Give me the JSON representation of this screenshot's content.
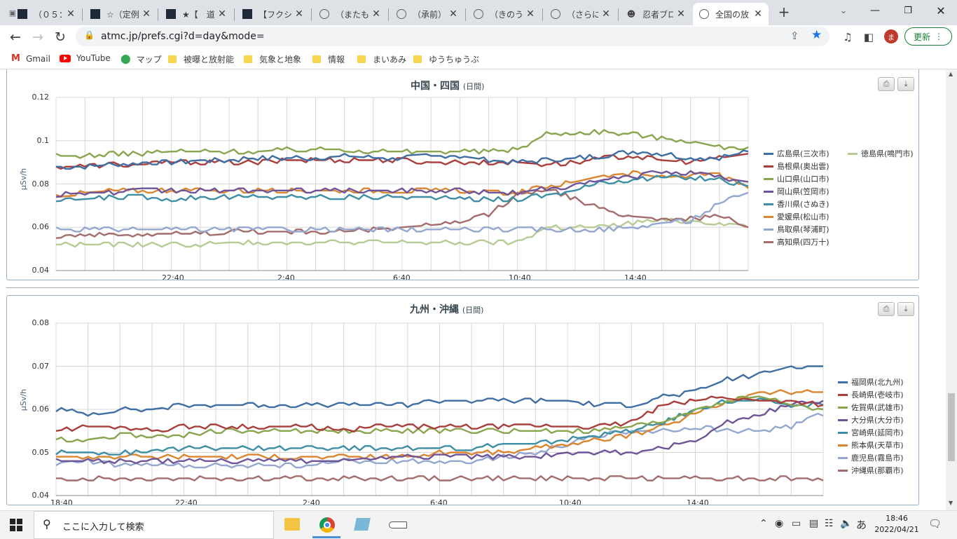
{
  "tabs": [
    {
      "title": "（０５：",
      "icon": "site-dark-icon"
    },
    {
      "title": "☆（定例",
      "icon": "site-dark-icon"
    },
    {
      "title": "★【　道",
      "icon": "site-dark-icon"
    },
    {
      "title": "【フクシマ",
      "icon": "site-dark-icon"
    },
    {
      "title": "（またも",
      "icon": "globe-icon"
    },
    {
      "title": "（承前）",
      "icon": "globe-icon"
    },
    {
      "title": "（きのう",
      "icon": "globe-icon"
    },
    {
      "title": "（さらに",
      "icon": "globe-icon"
    },
    {
      "title": "忍者ブロ",
      "icon": "ninja-icon"
    },
    {
      "title": "全国の放",
      "icon": "globe-icon"
    }
  ],
  "address": {
    "url": "atmc.jp/prefs.cgi?d=day&mode="
  },
  "profile": {
    "initial": "ま"
  },
  "update_button": {
    "label": "更新"
  },
  "bookmarks": [
    {
      "label": "Gmail",
      "icon": "gmail-icon"
    },
    {
      "label": "YouTube",
      "icon": "youtube-icon"
    },
    {
      "label": "マップ",
      "icon": "maps-icon"
    },
    {
      "label": "被曝と放射能",
      "icon": "folder-icon"
    },
    {
      "label": "気象と地象",
      "icon": "folder-icon"
    },
    {
      "label": "情報",
      "icon": "folder-icon"
    },
    {
      "label": "まいあみ",
      "icon": "folder-icon"
    },
    {
      "label": "ゆうちゅうぶ",
      "icon": "folder-icon"
    }
  ],
  "chart_data": [
    {
      "type": "line",
      "title": "中国・四国",
      "subtitle": "(日間)",
      "ylabel": "μSv/h",
      "ylim": [
        0.04,
        0.12
      ],
      "yticks": [
        "0.12",
        "0.1",
        "0.08",
        "0.06",
        "0.04"
      ],
      "xticks": [
        "22:40",
        "2:40",
        "6:40",
        "10:40",
        "14:40"
      ],
      "grid": true,
      "legend_position": "right",
      "x_hours": [
        0,
        1,
        2,
        3,
        4,
        5,
        6,
        7,
        8,
        9,
        10,
        11,
        12,
        13,
        14,
        15,
        16,
        17,
        18,
        19,
        20,
        21,
        22,
        23,
        24
      ],
      "series": [
        {
          "name": "広島県(三次市)",
          "color": "#3f6ea3",
          "values": [
            0.088,
            0.088,
            0.089,
            0.09,
            0.09,
            0.091,
            0.091,
            0.092,
            0.092,
            0.092,
            0.093,
            0.092,
            0.092,
            0.093,
            0.093,
            0.091,
            0.09,
            0.091,
            0.092,
            0.093,
            0.095,
            0.094,
            0.092,
            0.092,
            0.095
          ]
        },
        {
          "name": "島根県(奥出雲)",
          "color": "#aa3e3b",
          "values": [
            0.088,
            0.088,
            0.089,
            0.089,
            0.09,
            0.09,
            0.09,
            0.09,
            0.091,
            0.091,
            0.091,
            0.091,
            0.091,
            0.09,
            0.09,
            0.09,
            0.09,
            0.089,
            0.09,
            0.092,
            0.093,
            0.091,
            0.09,
            0.092,
            0.094
          ]
        },
        {
          "name": "山口県(山口市)",
          "color": "#89a54e",
          "values": [
            0.093,
            0.093,
            0.094,
            0.094,
            0.095,
            0.095,
            0.095,
            0.095,
            0.096,
            0.096,
            0.096,
            0.095,
            0.095,
            0.095,
            0.095,
            0.095,
            0.096,
            0.103,
            0.104,
            0.104,
            0.103,
            0.101,
            0.1,
            0.097,
            0.097
          ]
        },
        {
          "name": "岡山県(笠岡市)",
          "color": "#6f5499",
          "values": [
            0.075,
            0.076,
            0.076,
            0.077,
            0.077,
            0.077,
            0.077,
            0.077,
            0.077,
            0.077,
            0.077,
            0.077,
            0.077,
            0.077,
            0.077,
            0.076,
            0.076,
            0.078,
            0.079,
            0.082,
            0.083,
            0.086,
            0.085,
            0.083,
            0.081
          ]
        },
        {
          "name": "香川県(さぬき)",
          "color": "#3e8fa6",
          "values": [
            0.072,
            0.073,
            0.074,
            0.074,
            0.073,
            0.074,
            0.074,
            0.074,
            0.074,
            0.074,
            0.074,
            0.074,
            0.074,
            0.074,
            0.073,
            0.073,
            0.073,
            0.075,
            0.077,
            0.081,
            0.082,
            0.083,
            0.083,
            0.082,
            0.079
          ]
        },
        {
          "name": "愛媛県(松山市)",
          "color": "#dc8531",
          "values": [
            0.075,
            0.076,
            0.077,
            0.077,
            0.077,
            0.077,
            0.077,
            0.077,
            0.077,
            0.077,
            0.077,
            0.077,
            0.077,
            0.077,
            0.077,
            0.076,
            0.076,
            0.079,
            0.081,
            0.084,
            0.085,
            0.083,
            0.084,
            0.084,
            0.078
          ]
        },
        {
          "name": "鳥取県(琴浦町)",
          "color": "#94a7d0",
          "values": [
            0.059,
            0.059,
            0.059,
            0.059,
            0.059,
            0.059,
            0.059,
            0.059,
            0.059,
            0.059,
            0.059,
            0.059,
            0.059,
            0.059,
            0.059,
            0.059,
            0.059,
            0.059,
            0.059,
            0.059,
            0.06,
            0.062,
            0.063,
            0.071,
            0.076
          ]
        },
        {
          "name": "高知県(四万十)",
          "color": "#a26d6b",
          "values": [
            0.056,
            0.057,
            0.056,
            0.057,
            0.057,
            0.057,
            0.058,
            0.058,
            0.058,
            0.058,
            0.058,
            0.059,
            0.06,
            0.061,
            0.062,
            0.066,
            0.075,
            0.078,
            0.073,
            0.068,
            0.065,
            0.064,
            0.064,
            0.065,
            0.061
          ]
        },
        {
          "name": "徳島県(鳴門市)",
          "color": "#b7cc94",
          "values": [
            0.052,
            0.052,
            0.052,
            0.052,
            0.052,
            0.052,
            0.053,
            0.053,
            0.053,
            0.053,
            0.053,
            0.053,
            0.053,
            0.053,
            0.053,
            0.053,
            0.053,
            0.06,
            0.06,
            0.06,
            0.062,
            0.063,
            0.063,
            0.062,
            0.061
          ]
        }
      ]
    },
    {
      "type": "line",
      "title": "九州・沖縄",
      "subtitle": "(日間)",
      "ylabel": "μSv/h",
      "ylim": [
        0.04,
        0.08
      ],
      "yticks": [
        "0.08",
        "0.07",
        "0.06",
        "0.05",
        "0.04"
      ],
      "xticks": [
        "18:40",
        "22:40",
        "2:40",
        "6:40",
        "10:40",
        "14:40"
      ],
      "grid": true,
      "legend_position": "right",
      "x_hours": [
        0,
        1,
        2,
        3,
        4,
        5,
        6,
        7,
        8,
        9,
        10,
        11,
        12,
        13,
        14,
        15,
        16,
        17,
        18,
        19,
        20,
        21,
        22,
        23,
        24
      ],
      "series": [
        {
          "name": "福岡県(北九州)",
          "color": "#3f6ea3",
          "values": [
            0.06,
            0.059,
            0.06,
            0.06,
            0.061,
            0.061,
            0.061,
            0.061,
            0.061,
            0.061,
            0.061,
            0.061,
            0.062,
            0.062,
            0.062,
            0.062,
            0.062,
            0.061,
            0.061,
            0.063,
            0.064,
            0.067,
            0.068,
            0.07,
            0.07
          ]
        },
        {
          "name": "長崎県(壱岐市)",
          "color": "#aa3e3b",
          "values": [
            0.055,
            0.056,
            0.056,
            0.055,
            0.056,
            0.056,
            0.056,
            0.056,
            0.056,
            0.055,
            0.056,
            0.056,
            0.056,
            0.056,
            0.056,
            0.056,
            0.056,
            0.056,
            0.057,
            0.061,
            0.062,
            0.063,
            0.062,
            0.062,
            0.061
          ]
        },
        {
          "name": "佐賀県(武雄市)",
          "color": "#89a54e",
          "values": [
            0.053,
            0.053,
            0.054,
            0.054,
            0.054,
            0.055,
            0.055,
            0.055,
            0.055,
            0.055,
            0.055,
            0.055,
            0.055,
            0.055,
            0.055,
            0.055,
            0.055,
            0.055,
            0.056,
            0.057,
            0.06,
            0.062,
            0.063,
            0.061,
            0.06
          ]
        },
        {
          "name": "大分県(大分市)",
          "color": "#6f5499",
          "values": [
            0.048,
            0.048,
            0.048,
            0.048,
            0.048,
            0.048,
            0.048,
            0.048,
            0.048,
            0.048,
            0.049,
            0.049,
            0.049,
            0.049,
            0.049,
            0.049,
            0.05,
            0.05,
            0.05,
            0.051,
            0.053,
            0.057,
            0.059,
            0.061,
            0.062
          ]
        },
        {
          "name": "宮崎県(延岡市)",
          "color": "#3e8fa6",
          "values": [
            0.05,
            0.05,
            0.05,
            0.05,
            0.051,
            0.051,
            0.051,
            0.051,
            0.051,
            0.051,
            0.051,
            0.051,
            0.051,
            0.051,
            0.052,
            0.052,
            0.053,
            0.054,
            0.055,
            0.057,
            0.06,
            0.062,
            0.062,
            0.061,
            0.061
          ]
        },
        {
          "name": "熊本県(天草市)",
          "color": "#dc8531",
          "values": [
            0.049,
            0.049,
            0.049,
            0.049,
            0.049,
            0.049,
            0.049,
            0.049,
            0.049,
            0.049,
            0.049,
            0.049,
            0.05,
            0.05,
            0.05,
            0.051,
            0.052,
            0.053,
            0.054,
            0.056,
            0.059,
            0.062,
            0.064,
            0.064,
            0.064
          ]
        },
        {
          "name": "鹿児島(霧島市)",
          "color": "#94a7d0",
          "values": [
            0.047,
            0.048,
            0.047,
            0.047,
            0.047,
            0.047,
            0.047,
            0.047,
            0.047,
            0.048,
            0.048,
            0.048,
            0.048,
            0.048,
            0.049,
            0.05,
            0.052,
            0.054,
            0.055,
            0.055,
            0.056,
            0.055,
            0.055,
            0.056,
            0.059
          ]
        },
        {
          "name": "沖縄県(那覇市)",
          "color": "#a26d6b",
          "values": [
            0.044,
            0.044,
            0.044,
            0.044,
            0.044,
            0.044,
            0.044,
            0.044,
            0.044,
            0.044,
            0.044,
            0.044,
            0.044,
            0.044,
            0.044,
            0.044,
            0.044,
            0.044,
            0.044,
            0.044,
            0.044,
            0.044,
            0.044,
            0.044,
            0.044
          ]
        }
      ]
    }
  ],
  "taskbar": {
    "search_placeholder": "ここに入力して検索",
    "ime": "あ",
    "time": "18:46",
    "date": "2022/04/21"
  }
}
